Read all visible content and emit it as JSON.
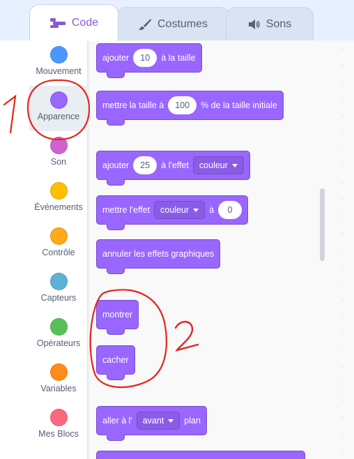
{
  "tabs": {
    "code": "Code",
    "costumes": "Costumes",
    "sons": "Sons"
  },
  "categories": [
    {
      "label": "Mouvement",
      "color": "#4c97ff"
    },
    {
      "label": "Apparence",
      "color": "#9966ff"
    },
    {
      "label": "Son",
      "color": "#cf63cf"
    },
    {
      "label": "Événements",
      "color": "#ffbf00"
    },
    {
      "label": "Contrôle",
      "color": "#ffab19"
    },
    {
      "label": "Capteurs",
      "color": "#5cb1d6"
    },
    {
      "label": "Opérateurs",
      "color": "#59c059"
    },
    {
      "label": "Variables",
      "color": "#ff8c1a"
    },
    {
      "label": "Mes Blocs",
      "color": "#ff6680"
    }
  ],
  "blocks": {
    "change_size": {
      "text_before": "ajouter",
      "value": "10",
      "text_after": "à la taille"
    },
    "set_size": {
      "text_before": "mettre la taille à",
      "value": "100",
      "text_after": "% de la taille initiale"
    },
    "change_effect": {
      "text_before": "ajouter",
      "value": "25",
      "text_mid": "à l'effet",
      "dropdown": "couleur"
    },
    "set_effect": {
      "text_before": "mettre l'effet",
      "dropdown": "couleur",
      "text_mid": "à",
      "value": "0"
    },
    "clear_effects": {
      "text": "annuler les effets graphiques"
    },
    "show": {
      "text": "montrer"
    },
    "hide": {
      "text": "cacher"
    },
    "go_to_layer": {
      "text_before": "aller à l'",
      "dropdown": "avant",
      "text_after": "plan"
    }
  },
  "annotations": {
    "one": "1",
    "two": "2",
    "color": "#e8231e"
  },
  "colors": {
    "looks_primary": "#9966ff",
    "looks_border": "#774dcb",
    "tab_accent": "#855cd6"
  }
}
